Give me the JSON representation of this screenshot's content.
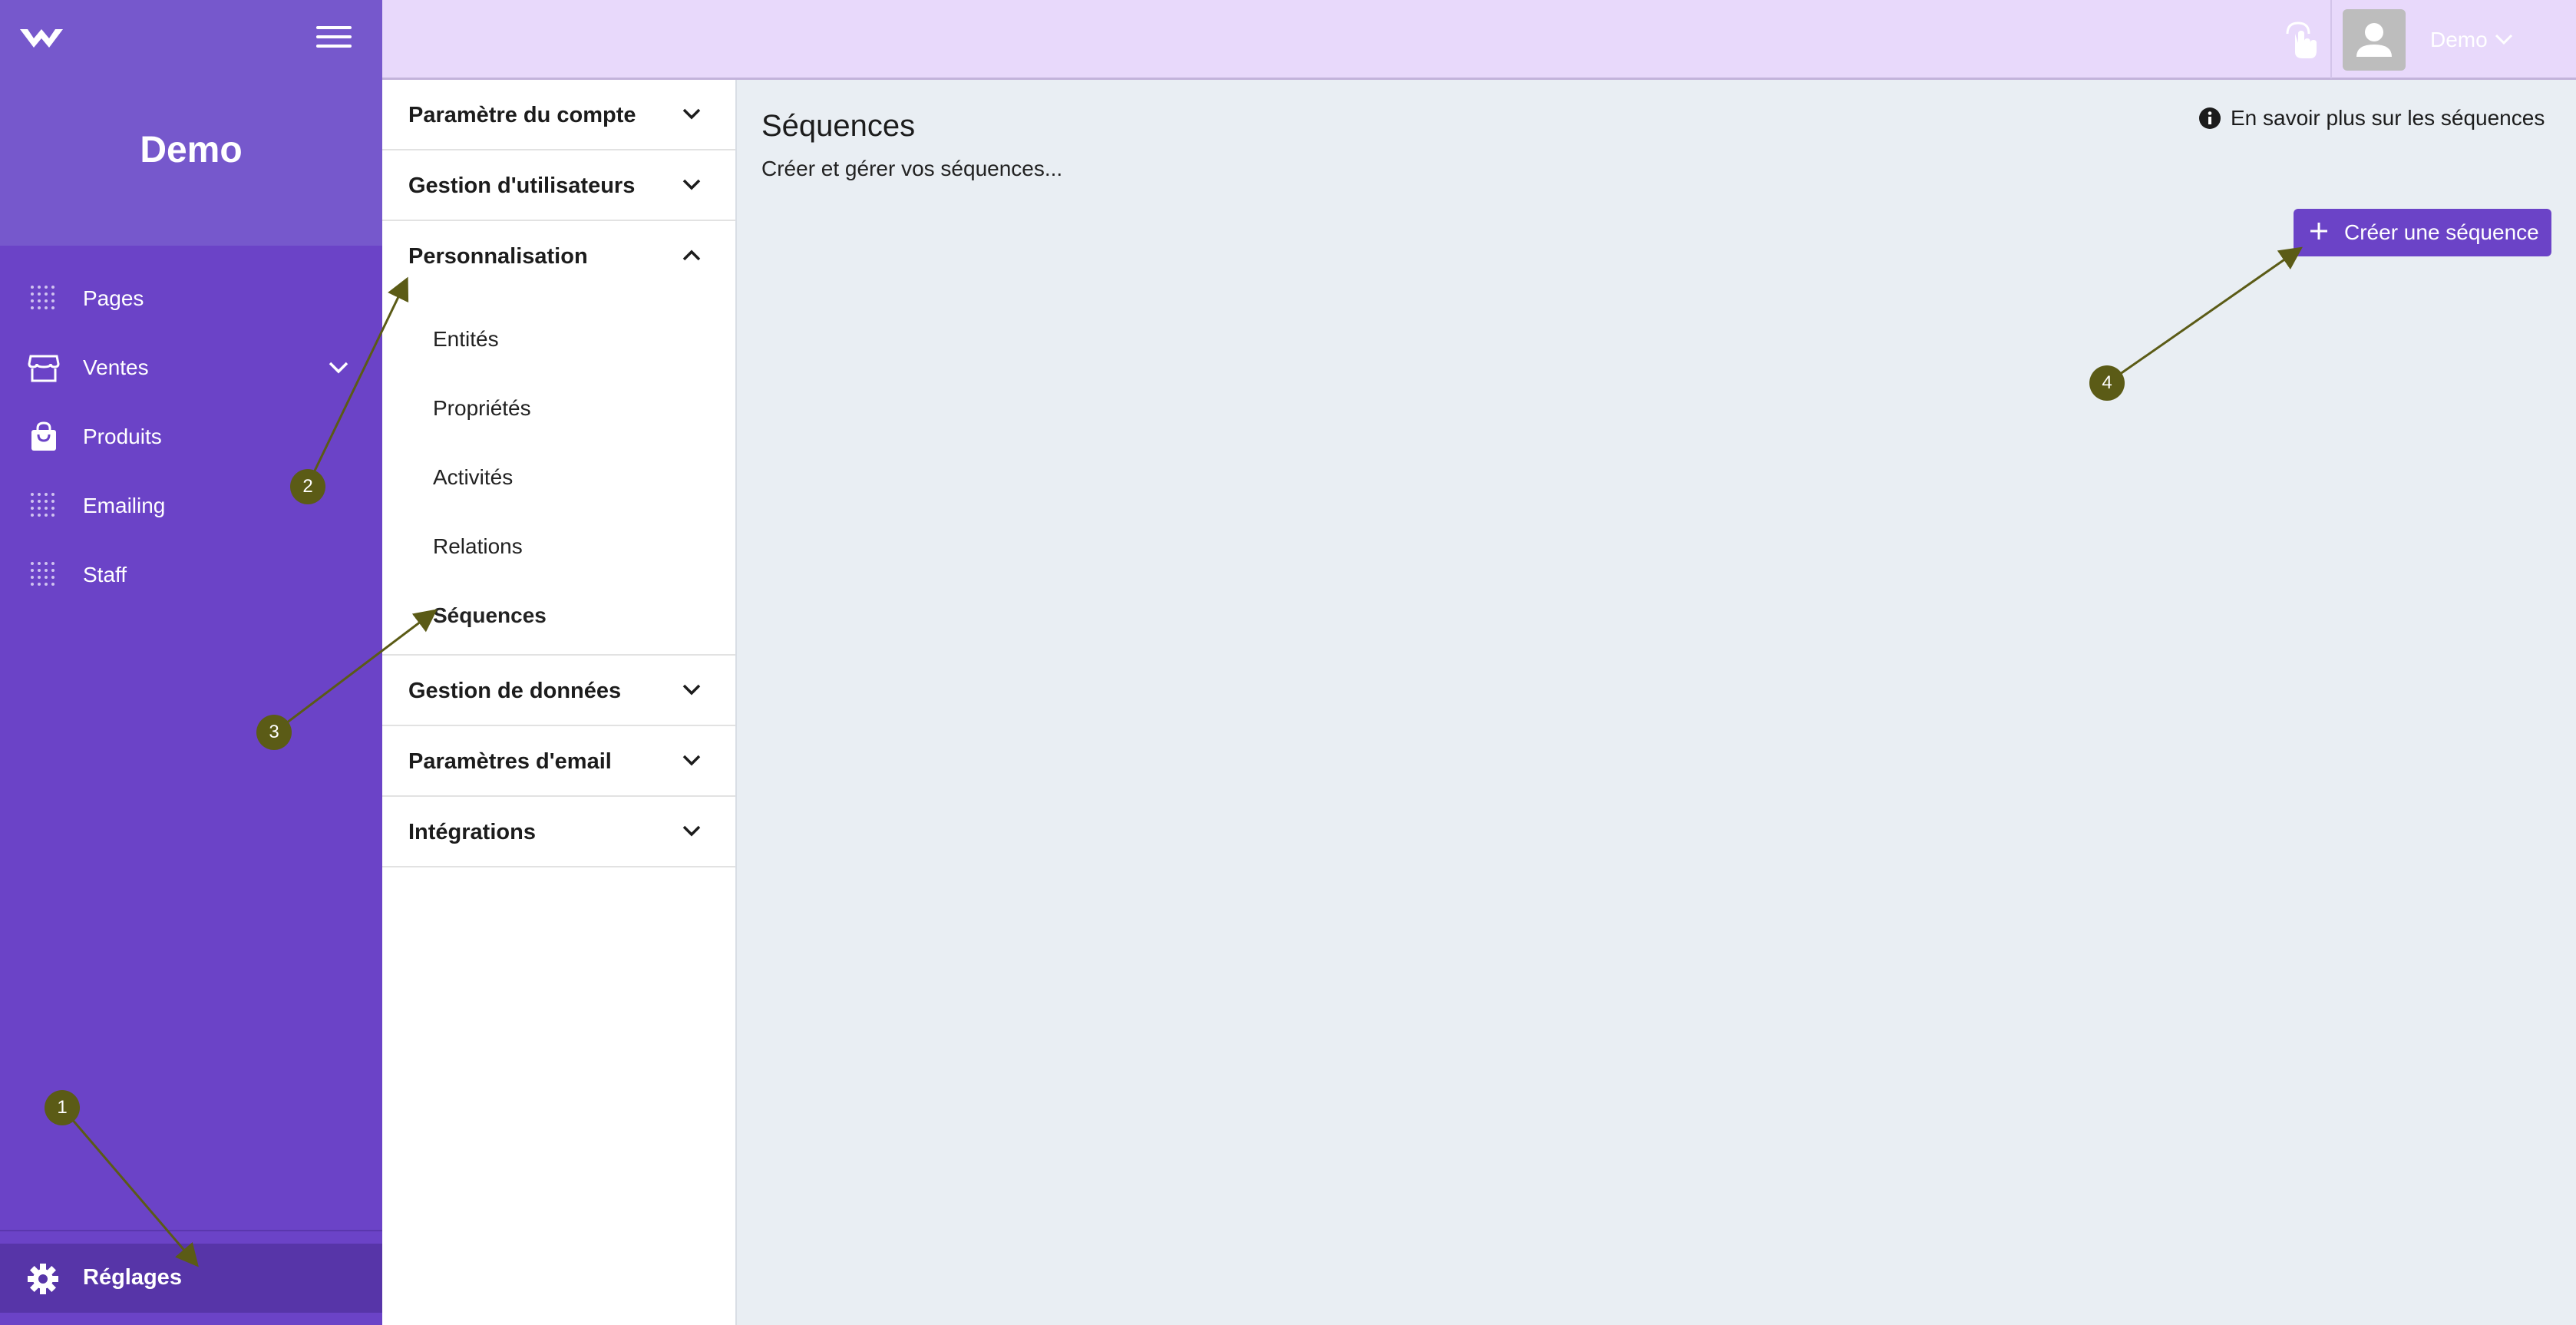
{
  "sidebar": {
    "brand": "Demo",
    "items": [
      {
        "label": "Pages",
        "icon": "grid-dots-icon"
      },
      {
        "label": "Ventes",
        "icon": "storefront-icon"
      },
      {
        "label": "Produits",
        "icon": "shopping-bag-icon"
      },
      {
        "label": "Emailing",
        "icon": "grid-dots-icon"
      },
      {
        "label": "Staff",
        "icon": "grid-dots-icon"
      }
    ],
    "settings_label": "Réglages"
  },
  "topbar": {
    "user_name": "Demo"
  },
  "settings_menu": {
    "sections": [
      {
        "label": "Paramètre du compte",
        "expanded": false
      },
      {
        "label": "Gestion d'utilisateurs",
        "expanded": false
      },
      {
        "label": "Personnalisation",
        "expanded": true
      },
      {
        "label": "Gestion de données",
        "expanded": false
      },
      {
        "label": "Paramètres d'email",
        "expanded": false
      },
      {
        "label": "Intégrations",
        "expanded": false
      }
    ],
    "personnalisation_items": [
      "Entités",
      "Propriétés",
      "Activités",
      "Relations",
      "Séquences"
    ],
    "active_item": "Séquences"
  },
  "main": {
    "title": "Séquences",
    "subtitle": "Créer et gérer vos séquences...",
    "learn_more": "En savoir plus sur les séquences",
    "create_button": "Créer une séquence"
  },
  "annotations": [
    "1",
    "2",
    "3",
    "4"
  ],
  "colors": {
    "sidebar": "#6b43c7",
    "sidebar_header": "#7658cc",
    "topbar": "#e8d9fb",
    "accent": "#6b43c7",
    "annotation": "#5b5b16",
    "main_bg": "#e9eef3"
  }
}
